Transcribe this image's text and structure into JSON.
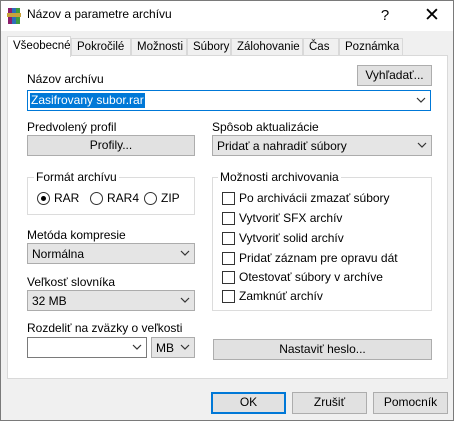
{
  "window": {
    "title": "Názov a parametre archívu",
    "help": "?",
    "close": "✕"
  },
  "tabs": [
    {
      "label": "Všeobecné"
    },
    {
      "label": "Pokročilé"
    },
    {
      "label": "Možnosti"
    },
    {
      "label": "Súbory"
    },
    {
      "label": "Zálohovanie"
    },
    {
      "label": "Čas"
    },
    {
      "label": "Poznámka"
    }
  ],
  "archive_name": {
    "label": "Názov archívu",
    "browse": "Vyhľadať...",
    "value": "Zasifrovany subor.rar"
  },
  "profile": {
    "label": "Predvolený profil",
    "button": "Profily..."
  },
  "update_mode": {
    "label": "Spôsob aktualizácie",
    "value": "Pridať a nahradiť súbory"
  },
  "format": {
    "label": "Formát archívu",
    "options": [
      "RAR",
      "RAR4",
      "ZIP"
    ],
    "selected": "RAR"
  },
  "method": {
    "label": "Metóda kompresie",
    "value": "Normálna"
  },
  "dict": {
    "label": "Veľkosť slovníka",
    "value": "32 MB"
  },
  "split": {
    "label": "Rozdeliť na zväzky o veľkosti",
    "value": "",
    "unit": "MB"
  },
  "options": {
    "label": "Možnosti archivovania",
    "items": [
      "Po archivácii zmazať súbory",
      "Vytvoriť SFX archív",
      "Vytvoriť solid archív",
      "Pridať záznam pre opravu dát",
      "Otestovať súbory v archíve",
      "Zamknúť archív"
    ]
  },
  "password_button": "Nastaviť heslo...",
  "footer": {
    "ok": "OK",
    "cancel": "Zrušiť",
    "help": "Pomocník"
  }
}
